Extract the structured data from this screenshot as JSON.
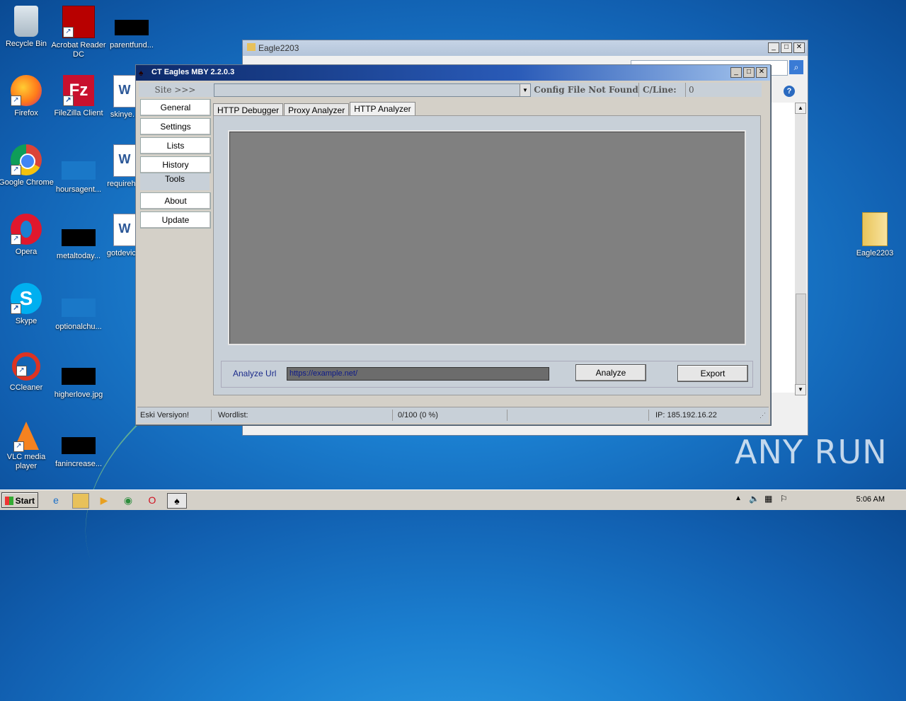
{
  "desktop": {
    "icons": [
      {
        "label": "Recycle Bin"
      },
      {
        "label": "Acrobat Reader DC"
      },
      {
        "label": "parentfund..."
      },
      {
        "label": "Firefox"
      },
      {
        "label": "FileZilla Client"
      },
      {
        "label": "skinye..."
      },
      {
        "label": "Google Chrome"
      },
      {
        "label": "hoursagent..."
      },
      {
        "label": "requireh..."
      },
      {
        "label": "Opera"
      },
      {
        "label": "metaltoday..."
      },
      {
        "label": "gotdevic..."
      },
      {
        "label": "Skype"
      },
      {
        "label": "optionalchu..."
      },
      {
        "label": "CCleaner"
      },
      {
        "label": "higherlove.jpg"
      },
      {
        "label": "VLC media player"
      },
      {
        "label": "fanincrease..."
      }
    ],
    "right_folder": "Eagle2203",
    "watermark": "ANY RUN"
  },
  "bg_window": {
    "title": "Eagle2203"
  },
  "app": {
    "title": "CT Eagles MBY 2.2.0.3",
    "site_label": "Site >>>",
    "site_value": "",
    "config_status": "Config File Not Found",
    "cline_label": "C/Line:",
    "cline_value": "0",
    "nav": [
      "General",
      "Settings",
      "Lists",
      "History",
      "Tools",
      "About",
      "Update"
    ],
    "active_nav": "Tools",
    "tabs": [
      "HTTP Debugger",
      "Proxy Analyzer",
      "HTTP Analyzer"
    ],
    "active_tab": "HTTP Analyzer",
    "analyze_label": "Analyze Url",
    "analyze_url": "https://example.net/",
    "analyze_button": "Analyze",
    "export_button": "Export",
    "status": {
      "version": "Eski Versiyon!",
      "wordlist": "Wordlist:",
      "progress": "0/100 (0 %)",
      "empty": "",
      "ip": "IP:  185.192.16.22"
    }
  },
  "taskbar": {
    "start": "Start",
    "clock": "5:06 AM"
  }
}
